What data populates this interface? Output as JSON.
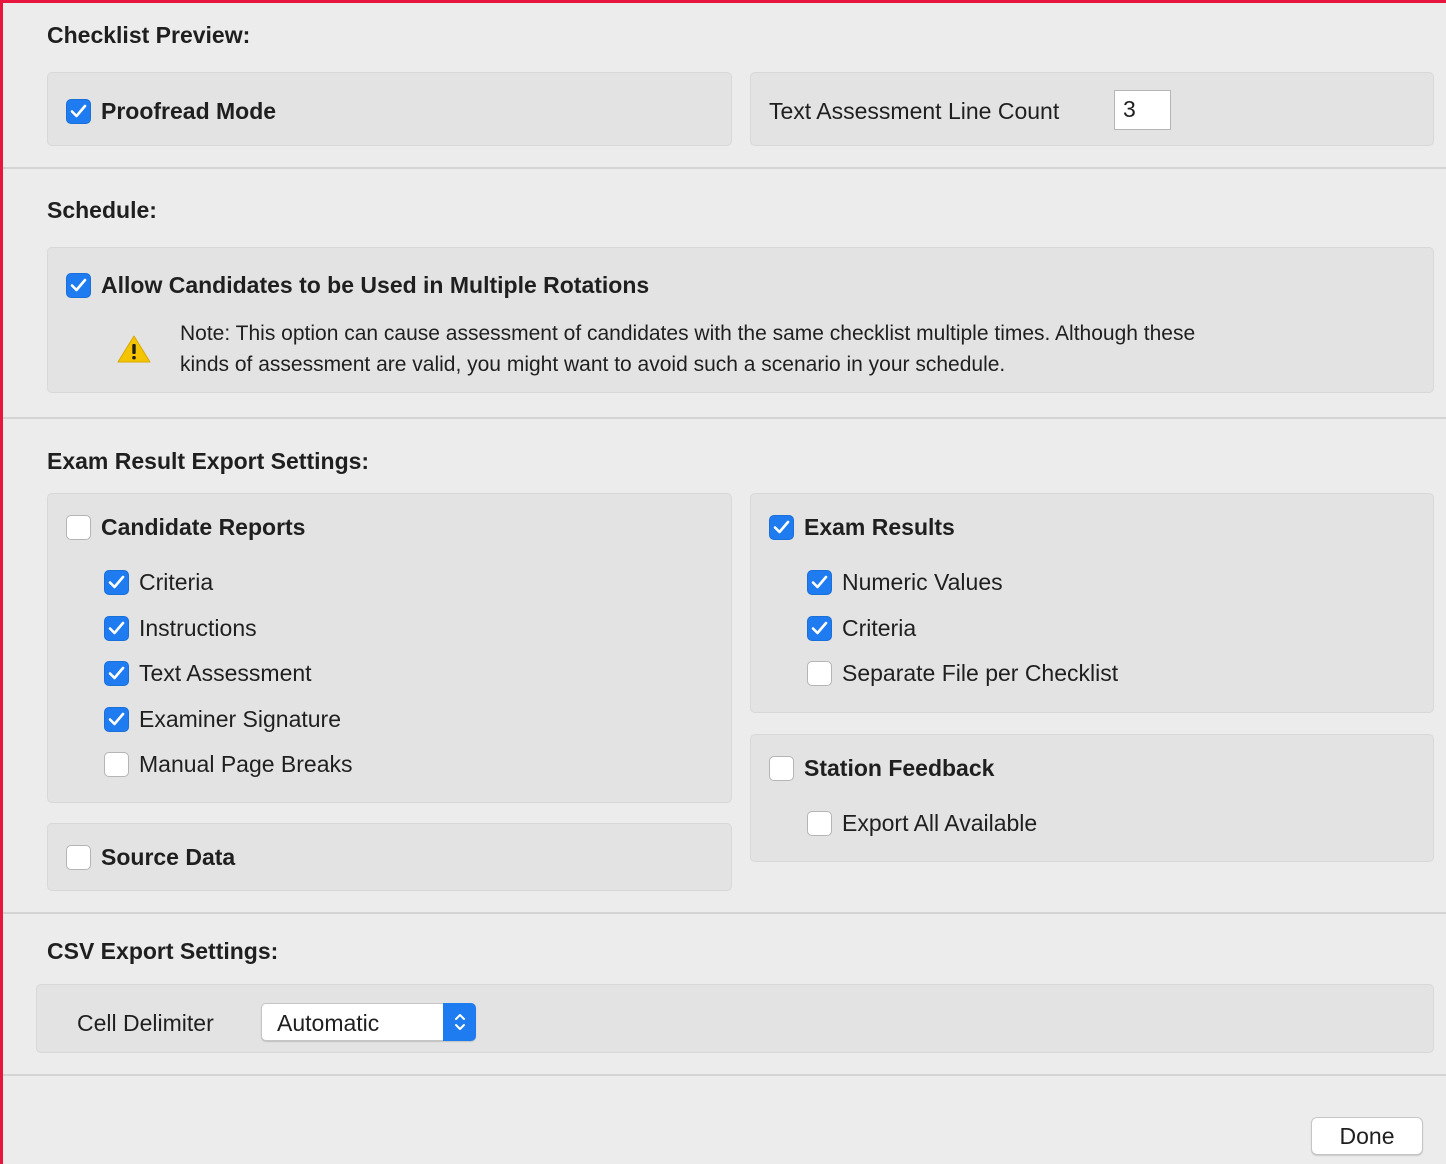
{
  "checklist_preview": {
    "heading": "Checklist Preview:",
    "proofread_mode": {
      "label": "Proofread Mode",
      "checked": true
    },
    "line_count": {
      "label": "Text Assessment Line Count",
      "value": "3"
    }
  },
  "schedule": {
    "heading": "Schedule:",
    "multiple_rotations": {
      "label": "Allow Candidates to be Used in Multiple Rotations",
      "checked": true
    },
    "note_line1": "Note: This option can cause assessment of candidates with the same checklist multiple times. Although these",
    "note_line2": "kinds of assessment are valid, you might want to avoid such a scenario in your schedule.",
    "note_icon": "warning-icon"
  },
  "export": {
    "heading": "Exam Result Export Settings:",
    "candidate_reports": {
      "label": "Candidate Reports",
      "checked": false,
      "items": [
        {
          "label": "Criteria",
          "checked": true
        },
        {
          "label": "Instructions",
          "checked": true
        },
        {
          "label": "Text Assessment",
          "checked": true
        },
        {
          "label": "Examiner Signature",
          "checked": true
        },
        {
          "label": "Manual Page Breaks",
          "checked": false
        }
      ]
    },
    "source_data": {
      "label": "Source Data",
      "checked": false
    },
    "exam_results": {
      "label": "Exam Results",
      "checked": true,
      "items": [
        {
          "label": "Numeric Values",
          "checked": true
        },
        {
          "label": "Criteria",
          "checked": true
        },
        {
          "label": "Separate File per Checklist",
          "checked": false
        }
      ]
    },
    "station_feedback": {
      "label": "Station Feedback",
      "checked": false,
      "items": [
        {
          "label": "Export All Available",
          "checked": false
        }
      ]
    }
  },
  "csv": {
    "heading": "CSV Export Settings:",
    "delimiter_label": "Cell Delimiter",
    "delimiter_value": "Automatic"
  },
  "footer": {
    "done_label": "Done"
  },
  "colors": {
    "accent": "#1f7bf0",
    "window_border": "#e8163f",
    "warning": "#f5c400"
  }
}
